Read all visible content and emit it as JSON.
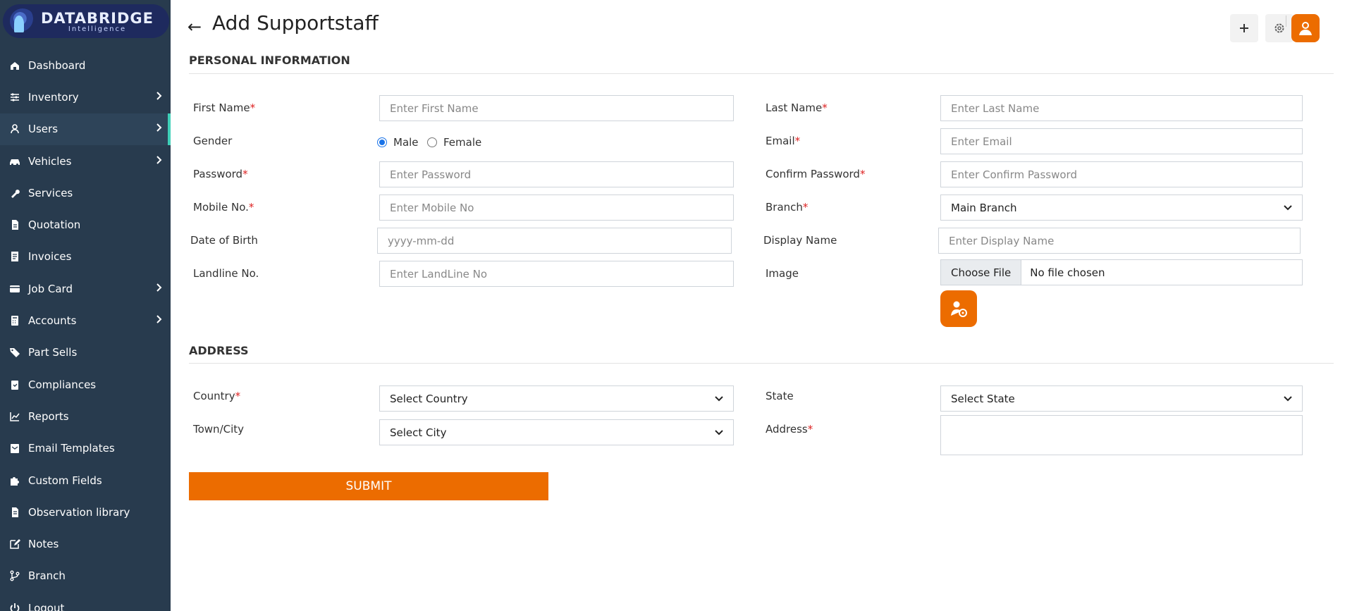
{
  "logo": {
    "name": "DATABRIDGE",
    "sub": "Intelligence"
  },
  "nav": [
    {
      "label": "Dashboard",
      "icon": "home-icon",
      "chevron": false
    },
    {
      "label": "Inventory",
      "icon": "sliders-icon",
      "chevron": true
    },
    {
      "label": "Users",
      "icon": "user-icon",
      "chevron": true,
      "active": true
    },
    {
      "label": "Vehicles",
      "icon": "car-icon",
      "chevron": true
    },
    {
      "label": "Services",
      "icon": "wrench-icon",
      "chevron": false
    },
    {
      "label": "Quotation",
      "icon": "document-icon",
      "chevron": false
    },
    {
      "label": "Invoices",
      "icon": "invoice-icon",
      "chevron": false
    },
    {
      "label": "Job Card",
      "icon": "card-icon",
      "chevron": true
    },
    {
      "label": "Accounts",
      "icon": "calculator-icon",
      "chevron": true
    },
    {
      "label": "Part Sells",
      "icon": "tag-icon",
      "chevron": false
    },
    {
      "label": "Compliances",
      "icon": "clipboard-icon",
      "chevron": false
    },
    {
      "label": "Reports",
      "icon": "chart-icon",
      "chevron": false
    },
    {
      "label": "Email Templates",
      "icon": "email-icon",
      "chevron": false
    },
    {
      "label": "Custom Fields",
      "icon": "puzzle-icon",
      "chevron": false
    },
    {
      "label": "Observation library",
      "icon": "file-icon",
      "chevron": false
    },
    {
      "label": "Notes",
      "icon": "edit-icon",
      "chevron": false
    },
    {
      "label": "Branch",
      "icon": "branch-icon",
      "chevron": false
    },
    {
      "label": "Logout",
      "icon": "power-icon",
      "chevron": false
    }
  ],
  "page": {
    "title": "Add Supportstaff"
  },
  "sections": {
    "personal": "PERSONAL INFORMATION",
    "address": "ADDRESS"
  },
  "form": {
    "first_name": {
      "label": "First Name",
      "placeholder": "Enter First Name"
    },
    "last_name": {
      "label": "Last Name",
      "placeholder": "Enter Last Name"
    },
    "gender": {
      "label": "Gender",
      "options": [
        "Male",
        "Female"
      ],
      "selected": "Male"
    },
    "email": {
      "label": "Email",
      "placeholder": "Enter Email"
    },
    "password": {
      "label": "Password",
      "placeholder": "Enter Password"
    },
    "confirm_password": {
      "label": "Confirm Password",
      "placeholder": "Enter Confirm Password"
    },
    "mobile": {
      "label": "Mobile No.",
      "placeholder": "Enter Mobile No"
    },
    "branch": {
      "label": "Branch",
      "value": "Main Branch"
    },
    "dob": {
      "label": "Date of Birth",
      "placeholder": "yyyy-mm-dd"
    },
    "display_name": {
      "label": "Display Name",
      "placeholder": "Enter Display Name"
    },
    "landline": {
      "label": "Landline No.",
      "placeholder": "Enter LandLine No"
    },
    "image": {
      "label": "Image",
      "button": "Choose File",
      "status": "No file chosen"
    },
    "country": {
      "label": "Country",
      "value": "Select Country"
    },
    "state": {
      "label": "State",
      "value": "Select State"
    },
    "city": {
      "label": "Town/City",
      "value": "Select City"
    },
    "address": {
      "label": "Address"
    }
  },
  "submit_label": "SUBMIT",
  "required_mark": "*",
  "colors": {
    "sidebar": "#283b4e",
    "accent": "#ec6c00",
    "active_marker": "#3fd0b8"
  }
}
